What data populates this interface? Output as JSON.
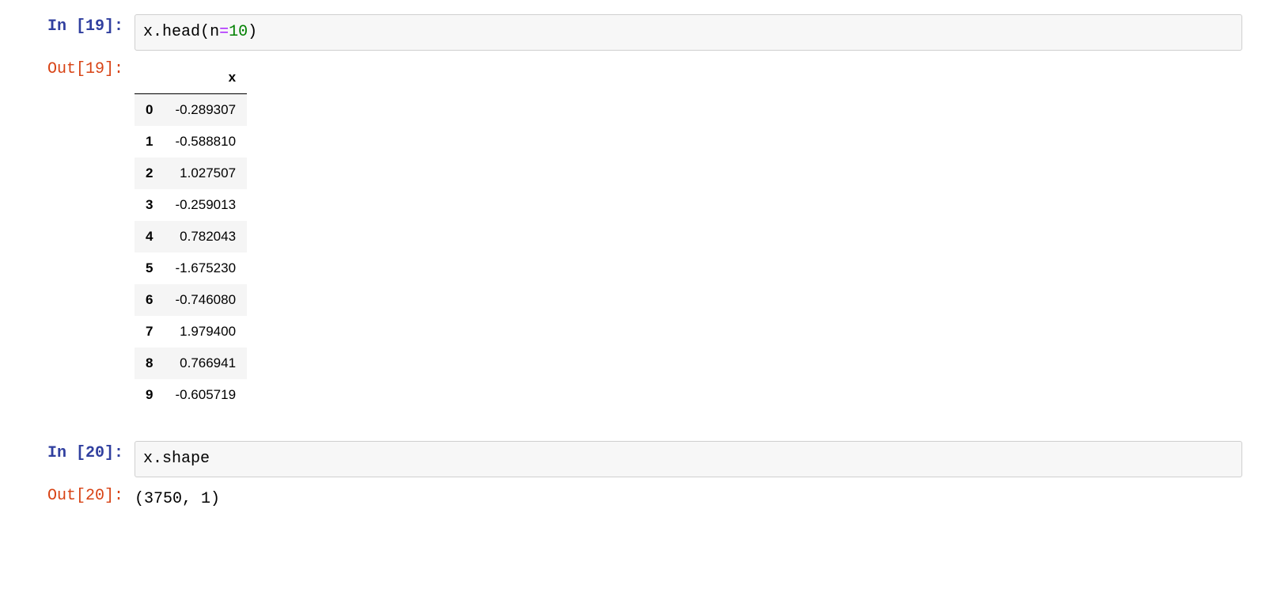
{
  "cells": [
    {
      "prompt_in": "In [19]:",
      "prompt_out": "Out[19]:",
      "code": {
        "var": "x",
        "dot1": ".",
        "method": "head",
        "lparen": "(",
        "kw": "n",
        "eq": "=",
        "arg": "10",
        "rparen": ")"
      },
      "dataframe": {
        "column_header": "x",
        "rows": [
          {
            "idx": "0",
            "val": "-0.289307"
          },
          {
            "idx": "1",
            "val": "-0.588810"
          },
          {
            "idx": "2",
            "val": "1.027507"
          },
          {
            "idx": "3",
            "val": "-0.259013"
          },
          {
            "idx": "4",
            "val": "0.782043"
          },
          {
            "idx": "5",
            "val": "-1.675230"
          },
          {
            "idx": "6",
            "val": "-0.746080"
          },
          {
            "idx": "7",
            "val": "1.979400"
          },
          {
            "idx": "8",
            "val": "0.766941"
          },
          {
            "idx": "9",
            "val": "-0.605719"
          }
        ]
      }
    },
    {
      "prompt_in": "In [20]:",
      "prompt_out": "Out[20]:",
      "code": {
        "var": "x",
        "dot1": ".",
        "prop": "shape"
      },
      "output_text": "(3750, 1)"
    }
  ]
}
